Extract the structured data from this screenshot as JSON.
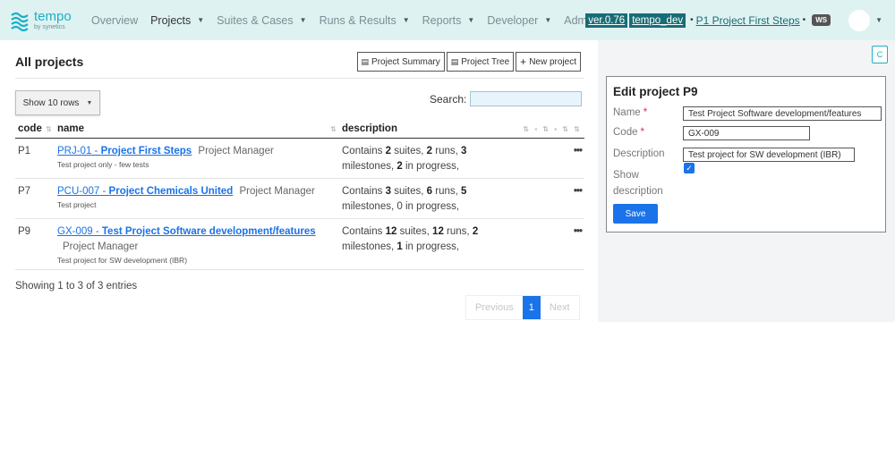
{
  "brand": {
    "name": "tempo",
    "tagline": "by synetics",
    "color": "#1ab0c4"
  },
  "nav": {
    "items": [
      {
        "label": "Overview",
        "active": false,
        "dropdown": false
      },
      {
        "label": "Projects",
        "active": true,
        "dropdown": true
      },
      {
        "label": "Suites & Cases",
        "active": false,
        "dropdown": true
      },
      {
        "label": "Runs & Results",
        "active": false,
        "dropdown": true
      },
      {
        "label": "Reports",
        "active": false,
        "dropdown": true
      },
      {
        "label": "Developer",
        "active": false,
        "dropdown": true
      },
      {
        "label": "Admin",
        "active": false,
        "dropdown": false
      }
    ],
    "version": "ver.0.76",
    "env": "tempo_dev",
    "current_project": "P1 Project First Steps",
    "workspace": "WS"
  },
  "main": {
    "title": "All projects",
    "toolbar": {
      "summary": "Project Summary",
      "tree": "Project Tree",
      "new_project": "New project"
    },
    "show_rows": "Show 10 rows",
    "search_label": "Search:",
    "columns": {
      "code": "code",
      "name": "name",
      "description": "description"
    },
    "rows": [
      {
        "code": "P1",
        "proj_code": "PRJ-01",
        "proj_name": "Project First Steps",
        "role": "Project Manager",
        "subtitle": "Test project only - few tests",
        "suites": "2",
        "runs": "2",
        "milestones": "3",
        "in_progress": "2"
      },
      {
        "code": "P7",
        "proj_code": "PCU-007",
        "proj_name": "Project Chemicals United",
        "role": "Project Manager",
        "subtitle": "Test project",
        "suites": "3",
        "runs": "6",
        "milestones": "5",
        "in_progress": "0"
      },
      {
        "code": "P9",
        "proj_code": "GX-009",
        "proj_name": "Test Project Software development/features",
        "role": "Project Manager",
        "subtitle": "Test project for SW development (IBR)",
        "suites": "12",
        "runs": "12",
        "milestones": "2",
        "in_progress": "1"
      }
    ],
    "desc_text": {
      "contains": "Contains",
      "suites": "suites,",
      "runs": "runs,",
      "milestones": "milestones,",
      "in_progress": "in progress,"
    },
    "showing": "Showing 1 to 3 of 3 entries",
    "pager": {
      "previous": "Previous",
      "page": "1",
      "next": "Next"
    }
  },
  "edit": {
    "collapse_label": "C",
    "title": "Edit project P9",
    "name_label": "Name",
    "name_value": "Test Project Software development/features",
    "code_label": "Code",
    "code_value": "GX-009",
    "description_label": "Description",
    "description_value": "Test project for SW development (IBR)",
    "show_label": "Show",
    "show_label2": "description",
    "show_checked": true,
    "save": "Save"
  },
  "colors": {
    "accent": "#1a73e8",
    "navbar": "#dff2f2",
    "dark_badge": "#176d77"
  }
}
